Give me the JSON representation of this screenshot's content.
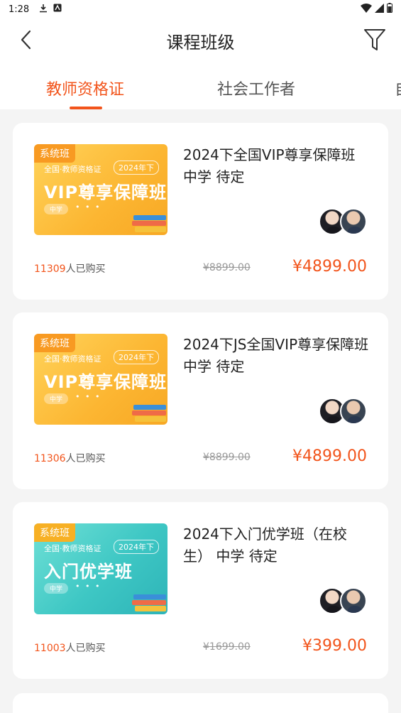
{
  "status_bar": {
    "time": "1:28"
  },
  "header": {
    "title": "课程班级",
    "back_icon": "chevron-left-icon",
    "filter_icon": "filter-funnel-icon"
  },
  "tabs": [
    {
      "label": "教师资格证",
      "active": true
    },
    {
      "label": "社会工作者",
      "active": false
    },
    {
      "label": "自",
      "active": false
    }
  ],
  "colors": {
    "accent": "#f2541b",
    "thumb_orange": "#fcb632",
    "thumb_teal": "#3ec7c4"
  },
  "courses": [
    {
      "badge": "系统班",
      "thumb_sub": "全国·教师资格证",
      "thumb_year": "2024年下",
      "thumb_big": "VIP尊享保障班",
      "thumb_pill": "中学",
      "thumb_style": "orange",
      "title": "2024下全国VIP尊享保障班 中学 待定",
      "buyers_count": "11309",
      "buyers_suffix": "人已购买",
      "original_price": "¥8899.00",
      "price": "¥4899.00"
    },
    {
      "badge": "系统班",
      "thumb_sub": "全国·教师资格证",
      "thumb_year": "2024年下",
      "thumb_big": "VIP尊享保障班",
      "thumb_pill": "中学",
      "thumb_style": "orange",
      "title": "2024下JS全国VIP尊享保障班 中学 待定",
      "buyers_count": "11306",
      "buyers_suffix": "人已购买",
      "original_price": "¥8899.00",
      "price": "¥4899.00"
    },
    {
      "badge": "系统班",
      "thumb_sub": "全国·教师资格证",
      "thumb_year": "2024年下",
      "thumb_big": "入门优学班",
      "thumb_pill": "中学",
      "thumb_style": "teal",
      "title": "2024下入门优学班（在校生） 中学 待定",
      "buyers_count": "11003",
      "buyers_suffix": "人已购买",
      "original_price": "¥1699.00",
      "price": "¥399.00"
    }
  ]
}
